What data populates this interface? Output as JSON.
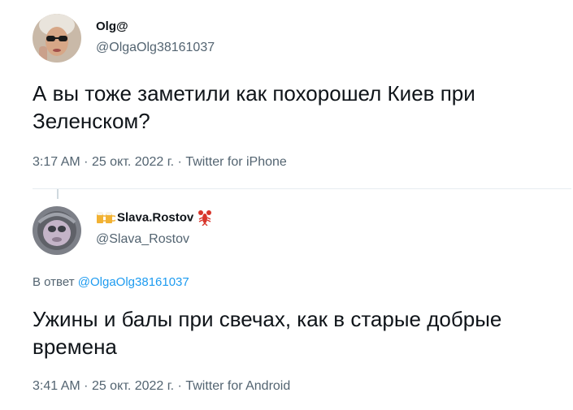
{
  "tweet1": {
    "display_name": "Olg@",
    "handle": "@OlgaOlg38161037",
    "text_line1": "А вы тоже заметили как похорошел Киев при",
    "text_line2": "Зеленском?",
    "time": "3:17 AM",
    "date": "25 окт. 2022 г.",
    "source": "Twitter for iPhone",
    "sep": "·"
  },
  "tweet2": {
    "display_name": "Slava.Rostov",
    "handle": "@Slava_Rostov",
    "reply_prefix": "В ответ",
    "reply_handle": "@OlgaOlg38161037",
    "text_line1": "Ужины и балы при свечах, как в старые добрые",
    "text_line2": "времена",
    "time": "3:41 AM",
    "date": "25 окт. 2022 г.",
    "source": "Twitter for Android",
    "sep": "·",
    "name_emoji_left": "beer-mugs-icon",
    "name_emoji_right": "lobster-icon"
  },
  "colors": {
    "text": "#0f1419",
    "secondary": "#536471",
    "link": "#1d9bf0",
    "divider": "#e6ecf0"
  }
}
